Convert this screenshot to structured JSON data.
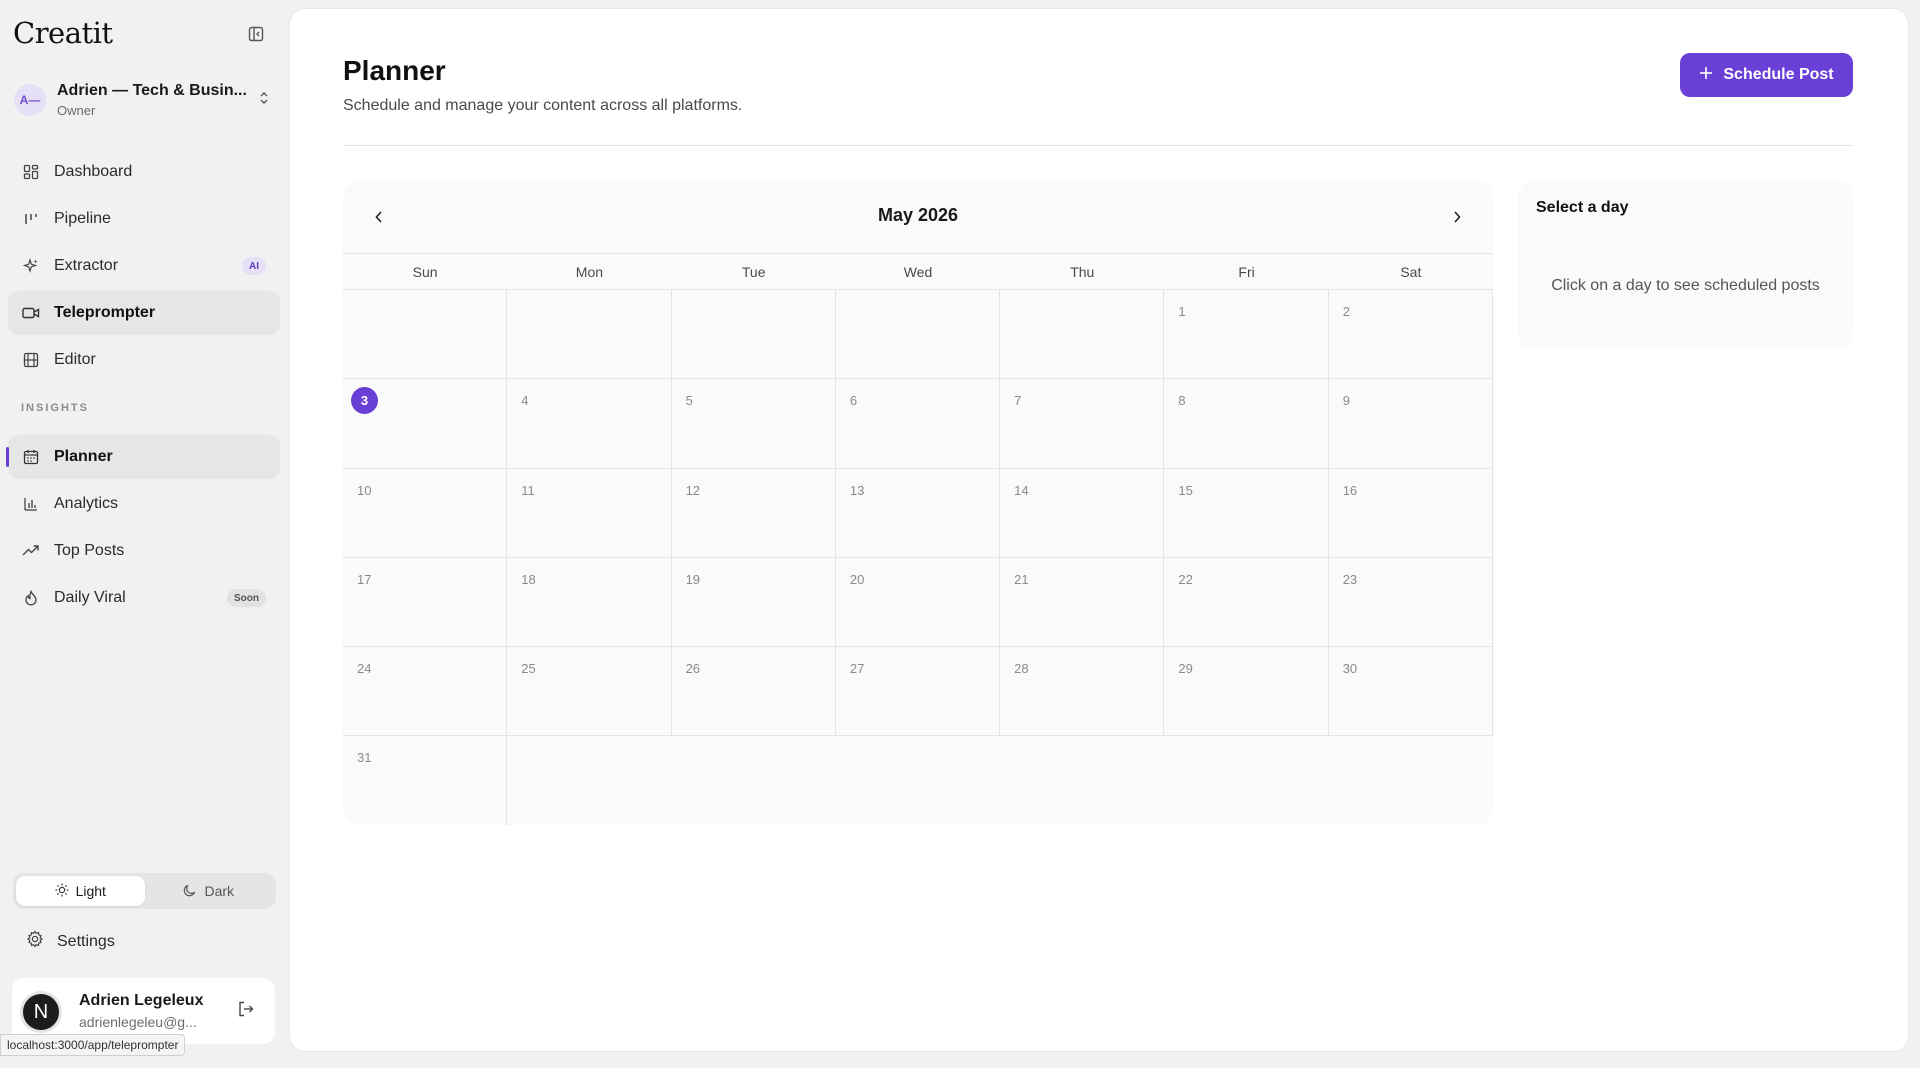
{
  "sidebar": {
    "logo": "Creatit",
    "workspace": {
      "initials": "A—",
      "name": "Adrien — Tech & Busin...",
      "role": "Owner"
    },
    "items": [
      {
        "label": "Dashboard",
        "icon": "dashboard-icon"
      },
      {
        "label": "Pipeline",
        "icon": "pipeline-icon"
      },
      {
        "label": "Extractor",
        "icon": "sparkle-icon",
        "badge": "AI"
      },
      {
        "label": "Teleprompter",
        "icon": "video-icon"
      },
      {
        "label": "Editor",
        "icon": "film-icon"
      }
    ],
    "section_label": "INSIGHTS",
    "insights": [
      {
        "label": "Planner",
        "icon": "calendar-icon"
      },
      {
        "label": "Analytics",
        "icon": "bar-chart-icon"
      },
      {
        "label": "Top Posts",
        "icon": "trending-icon"
      },
      {
        "label": "Daily Viral",
        "icon": "flame-icon",
        "badge": "Soon"
      }
    ],
    "theme": {
      "light": "Light",
      "dark": "Dark",
      "selected": "Light"
    },
    "settings_label": "Settings",
    "user": {
      "initial": "N",
      "name": "Adrien Legeleux",
      "email": "adrienlegeleu@g..."
    }
  },
  "status_url": "localhost:3000/app/teleprompter",
  "main": {
    "title": "Planner",
    "subtitle": "Schedule and manage your content across all platforms.",
    "schedule_button": "Schedule Post"
  },
  "calendar": {
    "month_label": "May 2026",
    "weekdays": [
      "Sun",
      "Mon",
      "Tue",
      "Wed",
      "Thu",
      "Fri",
      "Sat"
    ],
    "first_weekday_index": 5,
    "days_in_month": 31,
    "today": 3
  },
  "day_panel": {
    "title": "Select a day",
    "hint": "Click on a day to see scheduled posts"
  },
  "colors": {
    "accent": "#6a3fd6"
  }
}
